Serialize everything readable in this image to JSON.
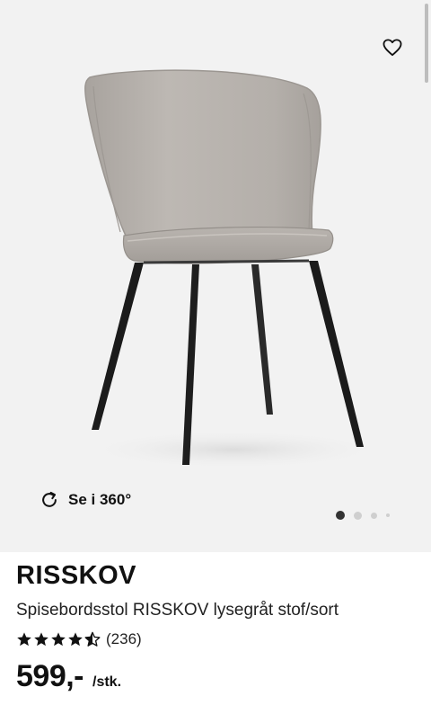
{
  "gallery": {
    "favorite_icon": "heart-outline-icon",
    "view_360_icon": "rotate-icon",
    "view_360_label": "Se i 360°",
    "slides_total": 4,
    "active_slide": 1
  },
  "product": {
    "name": "RISSKOV",
    "description": "Spisebordsstol RISSKOV lysegråt stof/sort",
    "rating": 4.5,
    "rating_max": 5,
    "review_count": "(236)",
    "price": "599,-",
    "price_unit": "/stk."
  },
  "colors": {
    "gallery_bg": "#f2f2f2",
    "text": "#111111",
    "dot_active": "#333333",
    "dot_inactive": "#cfcfcf"
  }
}
